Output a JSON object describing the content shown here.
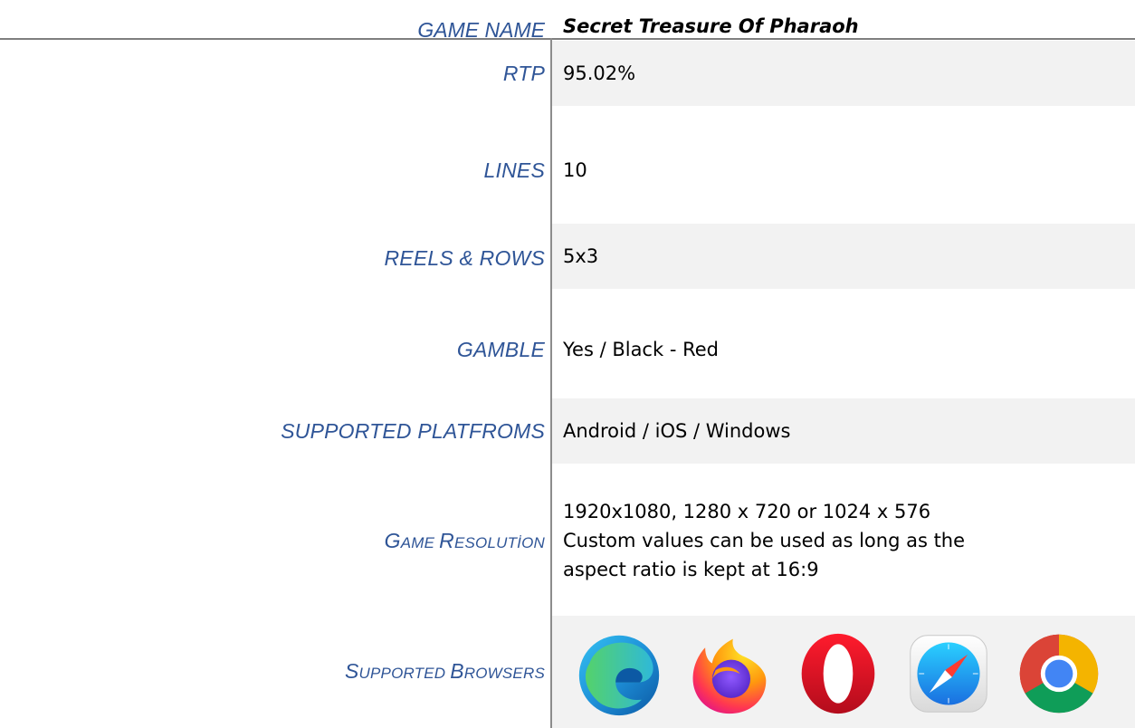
{
  "header": {
    "label": "GAME NAME",
    "value": "Secret Treasure Of Pharaoh"
  },
  "rows": [
    {
      "label": "RTP",
      "value": "95.02%"
    },
    {
      "label": "LINES",
      "value": "10"
    },
    {
      "label": "REELS & ROWS",
      "value": "5x3"
    },
    {
      "label": "GAMBLE",
      "value": "Yes / Black - Red"
    },
    {
      "label": "SUPPORTED PLATFROMS",
      "value": "Android / iOS / Windows"
    }
  ],
  "resolution": {
    "label_parts": [
      "G",
      "AME ",
      "R",
      "ESOLUTİON"
    ],
    "lines": [
      "1920x1080, 1280 x 720 or 1024 x 576",
      "Custom values can be used as long as the",
      "aspect ratio is kept at 16:9"
    ]
  },
  "browsers": {
    "label_parts": [
      "S",
      "UPPORTED ",
      "B",
      "ROWSERS"
    ],
    "icons": [
      "edge-icon",
      "firefox-icon",
      "opera-icon",
      "safari-icon",
      "chrome-icon"
    ]
  },
  "colors": {
    "label_blue": "#2f5597",
    "cell_gray": "#f2f2f2",
    "divider": "#8c8c8c"
  }
}
